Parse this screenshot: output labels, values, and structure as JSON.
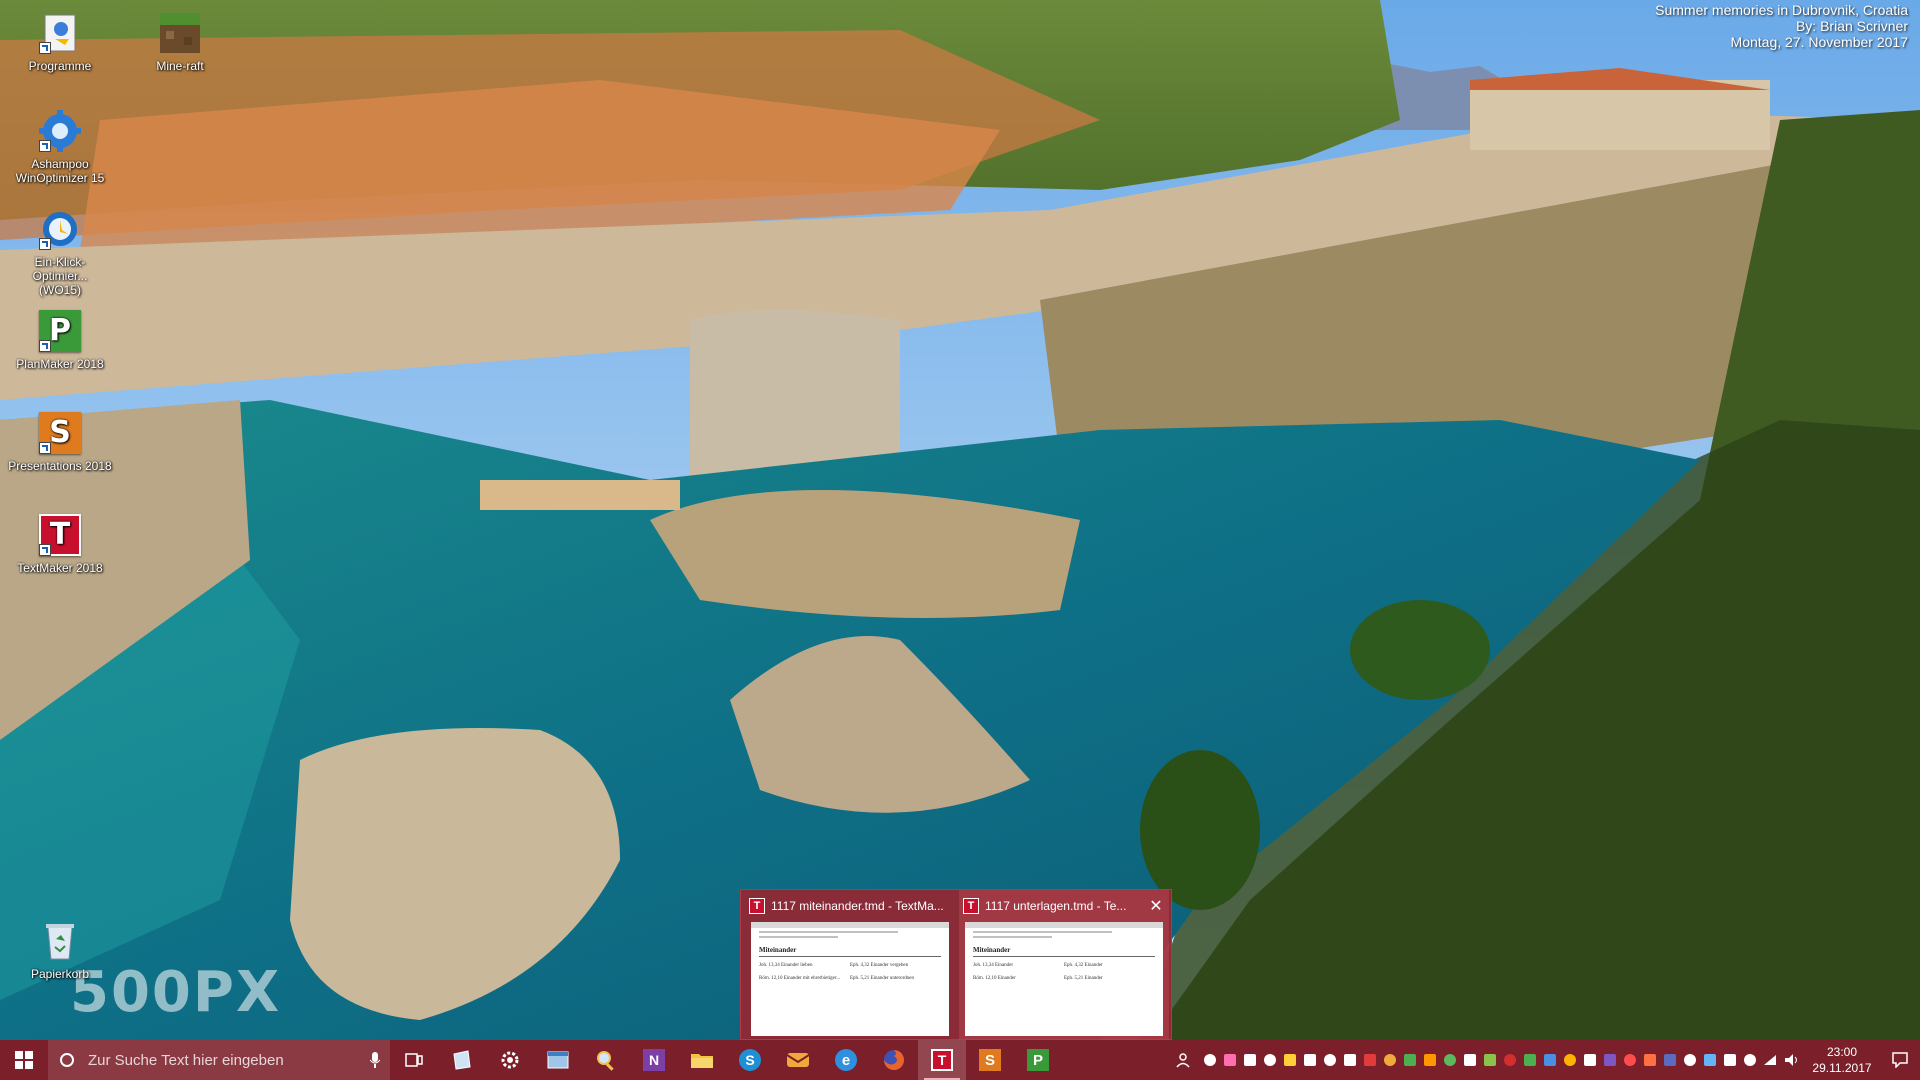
{
  "wallpaper": {
    "caption_lines": [
      "Summer memories in Dubrovnik, Croatia",
      "By: Brian Scrivner",
      "Montag, 27. November 2017"
    ],
    "watermark": "500PX"
  },
  "desktop_icons": [
    {
      "label": "Programme",
      "icon": "programs-shortcut-icon"
    },
    {
      "label": "Mine-raft",
      "icon": "minecraft-icon"
    },
    {
      "label": "Ashampoo\nWinOptimizer 15",
      "icon": "winoptimizer-gear-icon"
    },
    {
      "label": "Ein-Klick-Optimier...\n(WO15)",
      "icon": "one-click-optimizer-icon"
    },
    {
      "label": "PlanMaker 2018",
      "icon": "planmaker-icon",
      "letter": "P",
      "color": "#3a9a3a"
    },
    {
      "label": "Presentations 2018",
      "icon": "presentations-icon",
      "letter": "S",
      "color": "#e07a1f"
    },
    {
      "label": "TextMaker 2018",
      "icon": "textmaker-icon",
      "letter": "T",
      "color": "#c8102e"
    },
    {
      "label": "Papierkorb",
      "icon": "recycle-bin-icon"
    }
  ],
  "thumbnails": [
    {
      "title": "1117 miteinander.tmd - TextMa...",
      "doc_heading": "Miteinander",
      "left_items": [
        "Joh. 13,34 Einander lieben",
        "Röm. 12,10 Einander mit ehrerbietiger..."
      ],
      "right_items": [
        "Eph. 4,32 Einander vergeben",
        "Eph. 5,21 Einander unterordnen"
      ]
    },
    {
      "title": "1117 unterlagen.tmd - Te...",
      "doc_heading": "Miteinander",
      "left_items": [
        "Joh. 13,34 Einander",
        "Röm. 12,10 Einander"
      ],
      "right_items": [
        "Eph. 4,32 Einander",
        "Eph. 5,21 Einander"
      ]
    }
  ],
  "taskbar": {
    "search_placeholder": "Zur Suche Text hier eingeben",
    "apps": [
      {
        "name": "task-view",
        "color": "#ffffff"
      },
      {
        "name": "notepad",
        "color": "#cfe3f5"
      },
      {
        "name": "settings",
        "color": "#ffffff"
      },
      {
        "name": "explorer-window",
        "color": "#9fc5e8"
      },
      {
        "name": "search-tool",
        "color": "#f2c14e"
      },
      {
        "name": "onenote",
        "color": "#7b3fa6"
      },
      {
        "name": "file-explorer",
        "color": "#f5c542"
      },
      {
        "name": "skype",
        "color": "#1f8fd6"
      },
      {
        "name": "mail",
        "color": "#f2a93b"
      },
      {
        "name": "edge",
        "color": "#2f8fe0"
      },
      {
        "name": "firefox",
        "color": "#e8642b"
      },
      {
        "name": "textmaker",
        "color": "#c8102e",
        "letter": "T"
      },
      {
        "name": "presentations",
        "color": "#e07a1f",
        "letter": "S"
      },
      {
        "name": "planmaker",
        "color": "#3a9a3a",
        "letter": "P"
      }
    ],
    "tray_colors": [
      "#ffffff",
      "#ff6fb0",
      "#ffffff",
      "#ffffff",
      "#ffcf3a",
      "#ffffff",
      "#ffffff",
      "#ffffff",
      "#e23b3b",
      "#f2a93b",
      "#4caf50",
      "#ff9800",
      "#5db85d",
      "#ffffff",
      "#8bc34a",
      "#d32f2f",
      "#4caf50",
      "#4a90e2",
      "#ffb300",
      "#ffffff",
      "#7e57c2",
      "#ff4d4d",
      "#ff7043",
      "#5c6bc0",
      "#ffffff",
      "#64b5f6",
      "#ffffff",
      "#ffffff"
    ],
    "clock_time": "23:00",
    "clock_date": "29.11.2017"
  }
}
